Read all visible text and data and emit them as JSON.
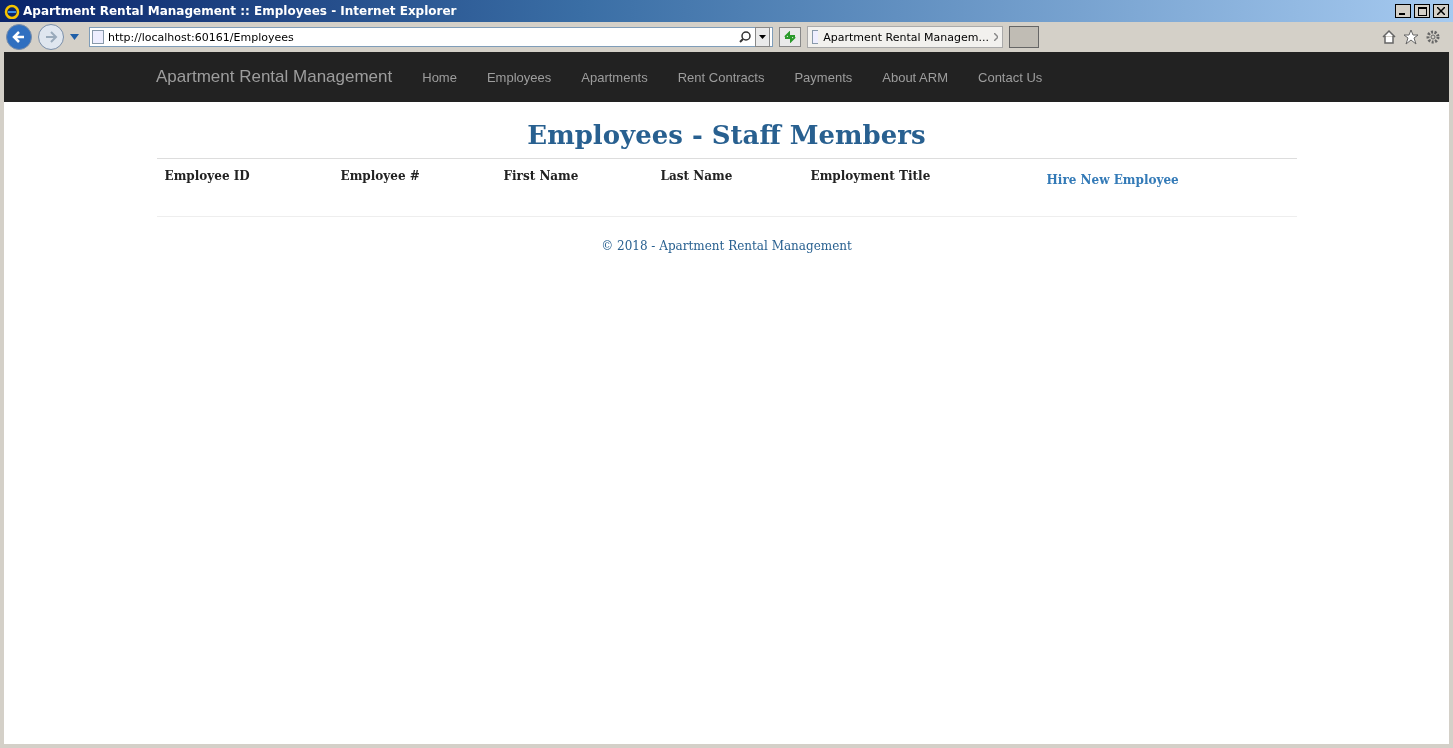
{
  "window": {
    "title": "Apartment Rental Management :: Employees - Internet Explorer"
  },
  "address_bar": {
    "value": "http://localhost:60161/Employees"
  },
  "tabs": [
    {
      "label": "Apartment Rental Managem...",
      "selected": true
    }
  ],
  "navbar": {
    "brand": "Apartment Rental Management",
    "items": [
      "Home",
      "Employees",
      "Apartments",
      "Rent Contracts",
      "Payments",
      "About ARM",
      "Contact Us"
    ]
  },
  "heading": "Employees - Staff Members",
  "table": {
    "columns": [
      "Employee ID",
      "Employee #",
      "First Name",
      "Last Name",
      "Employment Title"
    ],
    "action_link": "Hire New Employee"
  },
  "footer": "© 2018 - Apartment Rental Management"
}
